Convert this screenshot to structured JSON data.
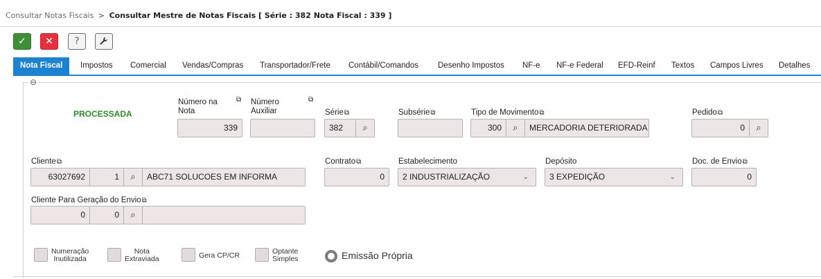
{
  "breadcrumb": {
    "parent": "Consultar Notas Fiscais",
    "separator": ">",
    "current": "Consultar Mestre de Notas Fiscais [ Série : 382 Nota Fiscal : 339 ]"
  },
  "toolbar": {
    "confirm": "✓",
    "cancel": "✕",
    "help": "?",
    "tools": "🔧"
  },
  "tabs": [
    {
      "label": "Nota Fiscal"
    },
    {
      "label": "Impostos"
    },
    {
      "label": "Comercial"
    },
    {
      "label": "Vendas/Compras"
    },
    {
      "label": "Transportador/Frete"
    },
    {
      "label": "Contábil/Comandos"
    },
    {
      "label": "Desenho Impostos"
    },
    {
      "label": "NF-e"
    },
    {
      "label": "NF-e Federal"
    },
    {
      "label": "EFD-Reinf"
    },
    {
      "label": "Textos"
    },
    {
      "label": "Campos Livres"
    },
    {
      "label": "Detalhes"
    }
  ],
  "status": "PROCESSADA",
  "fields": {
    "numero_nota": {
      "label_line1": "Número na",
      "label_line2": "Nota",
      "value": "339"
    },
    "numero_auxiliar": {
      "label_line1": "Número",
      "label_line2": "Auxiliar",
      "value": ""
    },
    "serie": {
      "label": "Série",
      "value": "382"
    },
    "subserie": {
      "label": "Subsérie",
      "value": ""
    },
    "tipo_movimento": {
      "label": "Tipo de Movimento",
      "code": "300",
      "description": "MERCADORIA DETERIORADA"
    },
    "pedido": {
      "label": "Pedido",
      "value": "0"
    },
    "cliente": {
      "label": "Cliente",
      "code": "63027692",
      "seq": "1",
      "name": "ABC71 SOLUCOES EM INFORMA"
    },
    "contrato": {
      "label": "Contrato",
      "value": "0"
    },
    "estabelecimento": {
      "label": "Estabelecimento",
      "value": "2 INDUSTRIALIZAÇÃO"
    },
    "deposito": {
      "label": "Depósito",
      "value": "3 EXPEDIÇÃO"
    },
    "doc_envio": {
      "label": "Doc. de Envio",
      "value": "0"
    },
    "cliente_envio": {
      "label": "Cliente Para Geração do Envio",
      "code": "0",
      "seq": "0",
      "name": ""
    }
  },
  "checkboxes": [
    {
      "line1": "Numeração",
      "line2": "Inutilizada"
    },
    {
      "line1": "Nota",
      "line2": "Extraviada"
    },
    {
      "line1": "Gera CP/CR",
      "line2": ""
    },
    {
      "line1": "Optante",
      "line2": "Simples"
    }
  ],
  "radio": {
    "label": "Emissão Própria"
  },
  "icons": {
    "copy": "⧉",
    "search": "🔍",
    "chevron": "﹀",
    "collapse": "⊖"
  }
}
